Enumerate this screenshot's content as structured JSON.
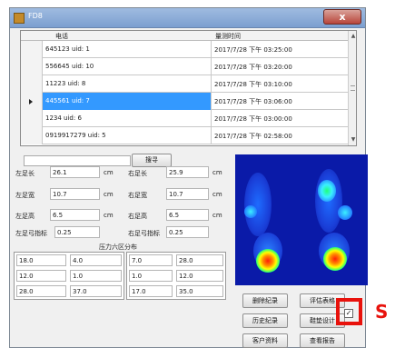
{
  "window": {
    "title": "FD8",
    "close": "x"
  },
  "table": {
    "columns": [
      "电话",
      "量测时间"
    ],
    "rows": [
      {
        "phone": "645123 uid: 1",
        "time": "2017/7/28 下午 03:25:00"
      },
      {
        "phone": "556645 uid: 10",
        "time": "2017/7/28 下午 03:20:00"
      },
      {
        "phone": "11223 uid: 8",
        "time": "2017/7/28 下午 03:10:00"
      },
      {
        "phone": "445561 uid: 7",
        "time": "2017/7/28 下午 03:06:00"
      },
      {
        "phone": "1234 uid: 6",
        "time": "2017/7/28 下午 03:00:00"
      },
      {
        "phone": "0919917279 uid: 5",
        "time": "2017/7/28 下午 02:58:00"
      }
    ],
    "selected_row": 3
  },
  "search": {
    "value": "",
    "button": "搜寻"
  },
  "measurements": {
    "left_length_label": "左足长",
    "left_length": "26.1",
    "right_length_label": "右足长",
    "right_length": "25.9",
    "left_width_label": "左足宽",
    "left_width": "10.7",
    "right_width_label": "右足宽",
    "right_width": "10.7",
    "left_height_label": "左足高",
    "left_height": "6.5",
    "right_height_label": "右足高",
    "right_height": "6.5",
    "left_arch_label": "左足弓指标",
    "left_arch": "0.25",
    "right_arch_label": "右足弓指标",
    "right_arch": "0.25",
    "unit": "cm"
  },
  "pressure": {
    "title": "压力六区分布",
    "left": [
      [
        "18.0",
        "4.0"
      ],
      [
        "12.0",
        "1.0"
      ],
      [
        "28.0",
        "37.0"
      ]
    ],
    "right": [
      [
        "7.0",
        "28.0"
      ],
      [
        "1.0",
        "12.0"
      ],
      [
        "17.0",
        "35.0"
      ]
    ]
  },
  "buttons": {
    "delete": "删除纪录",
    "evaluate": "评估表格",
    "history": "历史纪录",
    "insole": "鞋垫设计",
    "customer": "客户资料",
    "report": "查看报告"
  },
  "checkbox": {
    "checked": true,
    "mark": "✓"
  },
  "annotation": {
    "letter": "S",
    "color": "#e8120c"
  },
  "colors": {
    "selection": "#3399ff",
    "heatmap_bg": "#0a1aa8"
  }
}
